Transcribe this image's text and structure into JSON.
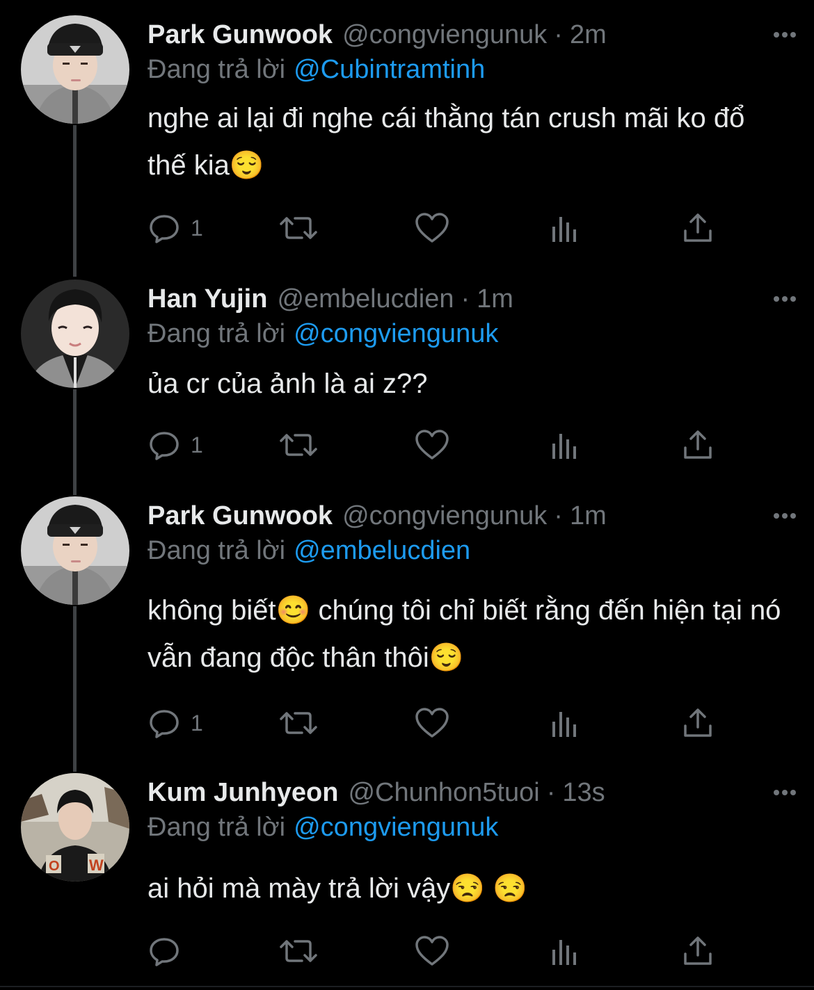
{
  "colors": {
    "background": "#000000",
    "text_primary": "#e7e9ea",
    "text_secondary": "#71767b",
    "accent": "#1d9bf0",
    "thread_line": "#3e4144"
  },
  "reply_prefix": "Đang trả lời",
  "tweets": [
    {
      "name": "Park Gunwook",
      "handle": "@congviengunuk",
      "separator": "·",
      "time": "2m",
      "reply_to": "@Cubintramtinh",
      "text": "nghe ai lại đi nghe cái thằng tán crush mãi ko đổ thế kia😌",
      "reply_count": "1",
      "avatar_icon": "avatar-park-gunwook"
    },
    {
      "name": "Han Yujin",
      "handle": "@embelucdien",
      "separator": "·",
      "time": "1m",
      "reply_to": "@congviengunuk",
      "text": "ủa cr của ảnh là ai z??",
      "reply_count": "1",
      "avatar_icon": "avatar-han-yujin"
    },
    {
      "name": "Park Gunwook",
      "handle": "@congviengunuk",
      "separator": "·",
      "time": "1m",
      "reply_to": "@embelucdien",
      "text": "không biết😊  chúng tôi chỉ biết rằng đến hiện tại nó vẫn đang độc thân thôi😌",
      "reply_count": "1",
      "avatar_icon": "avatar-park-gunwook"
    },
    {
      "name": "Kum Junhyeon",
      "handle": "@Chunhon5tuoi",
      "separator": "·",
      "time": "13s",
      "reply_to": "@congviengunuk",
      "text": "ai hỏi mà mày trả lời vậy😒 😒",
      "reply_count": "",
      "avatar_icon": "avatar-kum-junhyeon"
    }
  ],
  "action_icons": [
    "reply-icon",
    "retweet-icon",
    "like-icon",
    "analytics-icon",
    "share-icon"
  ],
  "more_icon": "more-options-icon"
}
